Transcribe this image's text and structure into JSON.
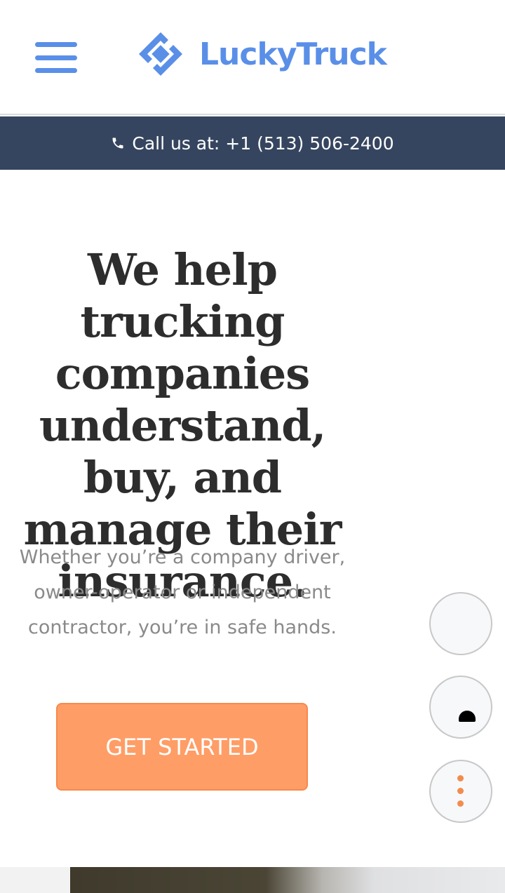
{
  "header": {
    "menu_icon": "hamburger-menu-icon",
    "logo_icon": "luckytruck-logo-mark",
    "logo_text": "LuckyTruck"
  },
  "callbar": {
    "phone_icon": "phone-icon",
    "text": "Call us at: +1 (513) 506-2400"
  },
  "hero": {
    "title": "We help trucking companies understand, buy, and manage their insurance.",
    "subtitle": "Whether you’re a company driver, owner-operator or independent contractor, you’re in safe hands.",
    "cta_label": "GET STARTED"
  },
  "floating_buttons": [
    {
      "icon": "blank-icon"
    },
    {
      "icon": "chat-icon"
    },
    {
      "icon": "more-vertical-icon"
    }
  ],
  "colors": {
    "brand_blue": "#5a8fe8",
    "callbar_bg": "#36455f",
    "cta_orange": "#ff9d66",
    "dots_orange": "#f28c4d"
  }
}
